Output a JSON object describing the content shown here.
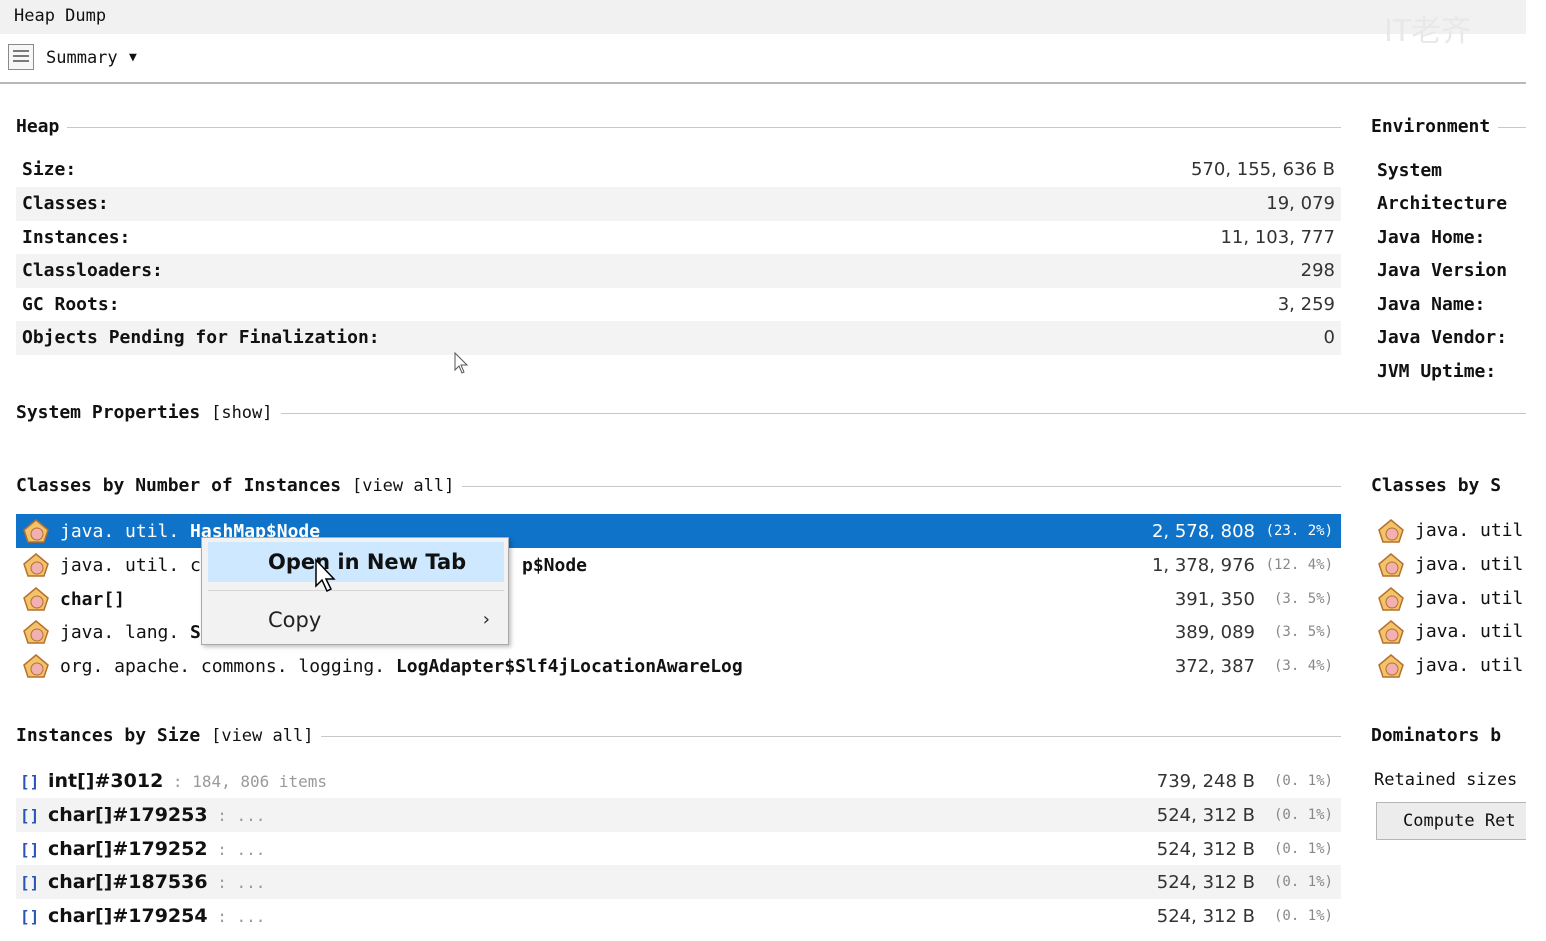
{
  "window": {
    "title": "Heap Dump",
    "watermark": "IT老齐"
  },
  "toolbar": {
    "view_label": "Summary"
  },
  "heap": {
    "title": "Heap",
    "rows": [
      {
        "label": "Size:",
        "value": "570, 155, 636 B"
      },
      {
        "label": "Classes:",
        "value": "19, 079"
      },
      {
        "label": "Instances:",
        "value": "11, 103, 777"
      },
      {
        "label": "Classloaders:",
        "value": "298"
      },
      {
        "label": "GC Roots:",
        "value": "3, 259"
      },
      {
        "label": "Objects Pending for Finalization:",
        "value": "0"
      }
    ]
  },
  "environment": {
    "title": "Environment",
    "labels": [
      "System",
      "Architecture",
      "Java Home:",
      "Java Version",
      "Java Name:",
      "Java Vendor:",
      "JVM Uptime:"
    ]
  },
  "system_properties": {
    "title": "System Properties",
    "link": "show"
  },
  "classes_by_instances": {
    "title": "Classes by Number of Instances",
    "link": "view  all",
    "rows": [
      {
        "prefix": "java. util. ",
        "name": "HashMap$Node",
        "count": "2, 578, 808",
        "pct": "(23. 2%)"
      },
      {
        "prefix": "java. util. con",
        "name": "p$Node",
        "count": "1, 378, 976",
        "pct": "(12. 4%)"
      },
      {
        "prefix": "",
        "name": "char[]",
        "count": "391, 350",
        "pct": "(3. 5%)"
      },
      {
        "prefix": "java. lang. ",
        "name": "St",
        "count": "389, 089",
        "pct": "(3. 5%)"
      },
      {
        "prefix": "org. apache. commons. logging. ",
        "name": "LogAdapter$Slf4jLocationAwareLog",
        "count": "372, 387",
        "pct": "(3. 4%)"
      }
    ]
  },
  "classes_by_size": {
    "title": "Classes by S",
    "items": [
      "java. util.",
      "java. util.",
      "java. util.",
      "java. util.",
      "java. util."
    ]
  },
  "instances_by_size": {
    "title": "Instances by Size",
    "link": "view  all",
    "rows": [
      {
        "name": "int[]#3012",
        "extra": " : 184, 806 items",
        "count": "739, 248 B",
        "pct": "(0. 1%)"
      },
      {
        "name": "char[]#179253",
        "extra": " : ...",
        "count": "524, 312 B",
        "pct": "(0. 1%)"
      },
      {
        "name": "char[]#179252",
        "extra": " : ...",
        "count": "524, 312 B",
        "pct": "(0. 1%)"
      },
      {
        "name": "char[]#187536",
        "extra": " : ...",
        "count": "524, 312 B",
        "pct": "(0. 1%)"
      },
      {
        "name": "char[]#179254",
        "extra": " : ...",
        "count": "524, 312 B",
        "pct": "(0. 1%)"
      }
    ]
  },
  "dominators": {
    "title": "Dominators b",
    "retained_label": "Retained sizes",
    "compute_button": "Compute Ret"
  },
  "context_menu": {
    "open_label": "Open in New Tab",
    "copy_label": "Copy",
    "submenu_glyph": "›"
  },
  "colors": {
    "selection": "#0f73c9",
    "menu_highlight": "#cde8ff",
    "instance_icon": "#2a55b8"
  }
}
